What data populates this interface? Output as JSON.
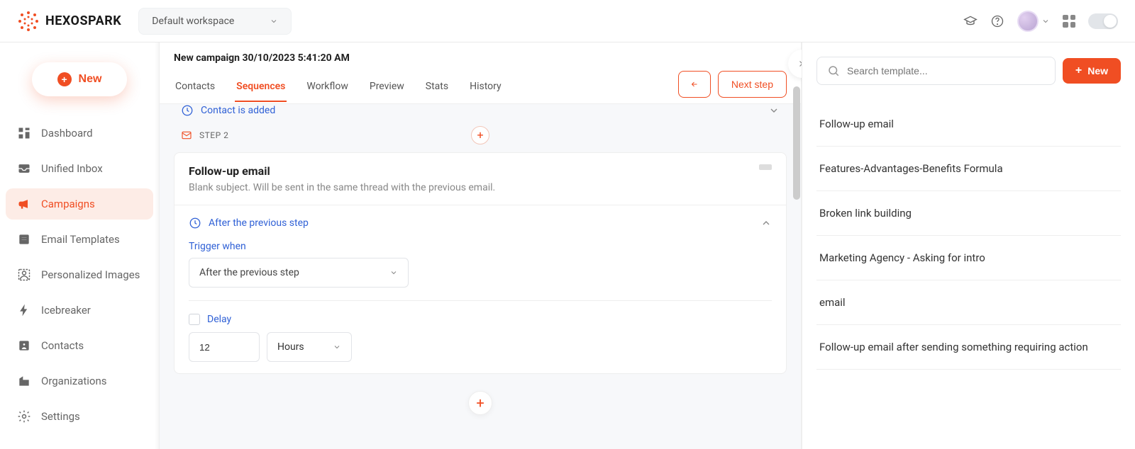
{
  "brand": "HEXOSPARK",
  "workspace": {
    "selected": "Default workspace"
  },
  "sidebar": {
    "newButton": "New",
    "items": [
      {
        "label": "Dashboard",
        "icon": "dashboard-icon",
        "active": false
      },
      {
        "label": "Unified Inbox",
        "icon": "inbox-icon",
        "active": false
      },
      {
        "label": "Campaigns",
        "icon": "megaphone-icon",
        "active": true
      },
      {
        "label": "Email Templates",
        "icon": "template-icon",
        "active": false
      },
      {
        "label": "Personalized Images",
        "icon": "image-icon",
        "active": false
      },
      {
        "label": "Icebreaker",
        "icon": "bolt-icon",
        "active": false
      },
      {
        "label": "Contacts",
        "icon": "contact-icon",
        "active": false
      },
      {
        "label": "Organizations",
        "icon": "org-icon",
        "active": false
      },
      {
        "label": "Settings",
        "icon": "gear-icon",
        "active": false
      }
    ]
  },
  "campaign": {
    "title": "New campaign 30/10/2023 5:41:20 AM",
    "tabs": [
      "Contacts",
      "Sequences",
      "Workflow",
      "Preview",
      "Stats",
      "History"
    ],
    "activeTab": "Sequences",
    "nextStepLabel": "Next step",
    "prevTrigger": "Contact is added",
    "stepLabel": "STEP 2",
    "card": {
      "title": "Follow-up email",
      "subtitle": "Blank subject. Will be sent in the same thread with the previous email.",
      "sectionTitle": "After the previous step",
      "triggerWhenLabel": "Trigger when",
      "triggerWhenValue": "After the previous step",
      "delayLabel": "Delay",
      "delayValue": "12",
      "delayUnit": "Hours"
    }
  },
  "templates": {
    "searchPlaceholder": "Search template...",
    "newLabel": "New",
    "items": [
      "Follow-up email",
      "Features-Advantages-Benefits Formula",
      "Broken link building",
      "Marketing Agency - Asking for intro",
      "email",
      "Follow-up email after sending something requiring action"
    ]
  }
}
